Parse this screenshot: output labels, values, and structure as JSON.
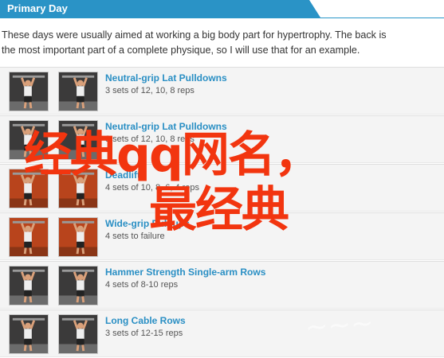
{
  "header": {
    "title": "Primary Day"
  },
  "intro": {
    "line1": "These days were usually aimed at working a big body part for hypertrophy. The back is",
    "line2": "the most important part of a complete physique, so I will use that for an example."
  },
  "exercises": [
    {
      "name": "Neutral-grip Lat Pulldowns",
      "reps": "3 sets of 12, 10, 8 reps",
      "scene": "gym-dark"
    },
    {
      "name": "Neutral-grip Lat Pulldowns",
      "reps": "3 sets of 12, 10, 8 reps",
      "scene": "gym-dark"
    },
    {
      "name": "Deadlifts",
      "reps": "4 sets of 10, 8, 6, 4 reps",
      "scene": "gym-orange"
    },
    {
      "name": "Wide-grip Pull-ups",
      "reps": "4 sets to failure",
      "scene": "gym-orange"
    },
    {
      "name": "Hammer Strength Single-arm Rows",
      "reps": "4 sets of 8-10 reps",
      "scene": "gym-dark"
    },
    {
      "name": "Long Cable Rows",
      "reps": "3 sets of 12-15 reps",
      "scene": "gym-dark"
    }
  ],
  "overlay": {
    "line1": "经典qq网名，",
    "line2": "最经典"
  },
  "colors": {
    "accent": "#2a93c6",
    "link": "#2a8fc4",
    "overlay_text": "#f2350f"
  }
}
